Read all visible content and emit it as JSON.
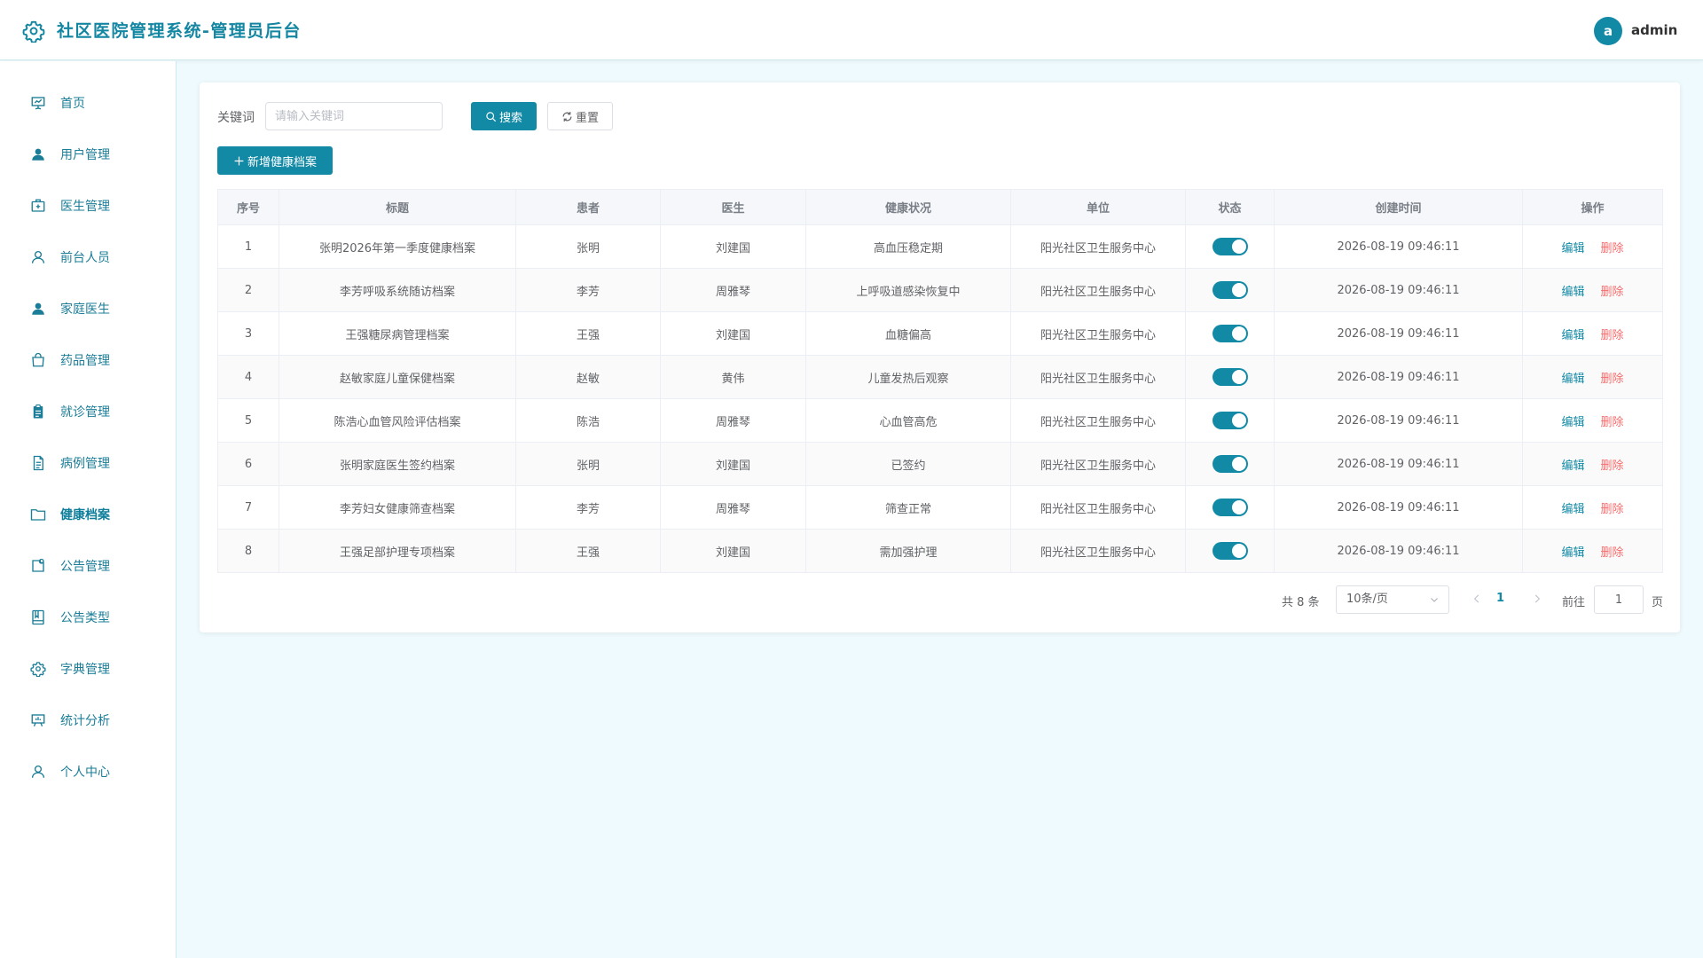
{
  "header": {
    "title": "社区医院管理系统-管理员后台",
    "avatar_letter": "a",
    "username": "admin"
  },
  "colors": {
    "accent": "#128aa6",
    "danger": "#f56c6c",
    "background": "#eefafd"
  },
  "sidebar": {
    "items": [
      {
        "label": "首页",
        "icon": "presentation-icon"
      },
      {
        "label": "用户管理",
        "icon": "user-filled-icon"
      },
      {
        "label": "医生管理",
        "icon": "first-aid-kit-icon"
      },
      {
        "label": "前台人员",
        "icon": "user-outline-icon"
      },
      {
        "label": "家庭医生",
        "icon": "user-filled-icon"
      },
      {
        "label": "药品管理",
        "icon": "shopping-bag-icon"
      },
      {
        "label": "就诊管理",
        "icon": "clipboard-icon"
      },
      {
        "label": "病例管理",
        "icon": "document-icon"
      },
      {
        "label": "健康档案",
        "icon": "folder-icon",
        "active": true
      },
      {
        "label": "公告管理",
        "icon": "message-box-icon"
      },
      {
        "label": "公告类型",
        "icon": "notebook-icon"
      },
      {
        "label": "字典管理",
        "icon": "setting-icon"
      },
      {
        "label": "统计分析",
        "icon": "data-board-icon"
      },
      {
        "label": "个人中心",
        "icon": "user-outline-icon"
      }
    ]
  },
  "search": {
    "keyword_label": "关键词",
    "placeholder": "请输入关键词",
    "value": "",
    "search_label": "搜索",
    "reset_label": "重置",
    "add_label": "新增健康档案"
  },
  "table": {
    "columns": [
      "序号",
      "标题",
      "患者",
      "医生",
      "健康状况",
      "单位",
      "状态",
      "创建时间",
      "操作"
    ],
    "edit_label": "编辑",
    "delete_label": "删除",
    "rows": [
      {
        "no": "1",
        "title": "张明2026年第一季度健康档案",
        "patient": "张明",
        "doctor": "刘建国",
        "condition": "高血压稳定期",
        "unit": "阳光社区卫生服务中心",
        "status": true,
        "created": "2026-08-19 09:46:11"
      },
      {
        "no": "2",
        "title": "李芳呼吸系统随访档案",
        "patient": "李芳",
        "doctor": "周雅琴",
        "condition": "上呼吸道感染恢复中",
        "unit": "阳光社区卫生服务中心",
        "status": true,
        "created": "2026-08-19 09:46:11"
      },
      {
        "no": "3",
        "title": "王强糖尿病管理档案",
        "patient": "王强",
        "doctor": "刘建国",
        "condition": "血糖偏高",
        "unit": "阳光社区卫生服务中心",
        "status": true,
        "created": "2026-08-19 09:46:11"
      },
      {
        "no": "4",
        "title": "赵敏家庭儿童保健档案",
        "patient": "赵敏",
        "doctor": "黄伟",
        "condition": "儿童发热后观察",
        "unit": "阳光社区卫生服务中心",
        "status": true,
        "created": "2026-08-19 09:46:11"
      },
      {
        "no": "5",
        "title": "陈浩心血管风险评估档案",
        "patient": "陈浩",
        "doctor": "周雅琴",
        "condition": "心血管高危",
        "unit": "阳光社区卫生服务中心",
        "status": true,
        "created": "2026-08-19 09:46:11"
      },
      {
        "no": "6",
        "title": "张明家庭医生签约档案",
        "patient": "张明",
        "doctor": "刘建国",
        "condition": "已签约",
        "unit": "阳光社区卫生服务中心",
        "status": true,
        "created": "2026-08-19 09:46:11"
      },
      {
        "no": "7",
        "title": "李芳妇女健康筛查档案",
        "patient": "李芳",
        "doctor": "周雅琴",
        "condition": "筛查正常",
        "unit": "阳光社区卫生服务中心",
        "status": true,
        "created": "2026-08-19 09:46:11"
      },
      {
        "no": "8",
        "title": "王强足部护理专项档案",
        "patient": "王强",
        "doctor": "刘建国",
        "condition": "需加强护理",
        "unit": "阳光社区卫生服务中心",
        "status": true,
        "created": "2026-08-19 09:46:11"
      }
    ]
  },
  "pagination": {
    "total_text": "共 8 条",
    "page_size": "10条/页",
    "current_page": "1",
    "goto_label": "前往",
    "goto_value": "1",
    "page_label": "页"
  }
}
